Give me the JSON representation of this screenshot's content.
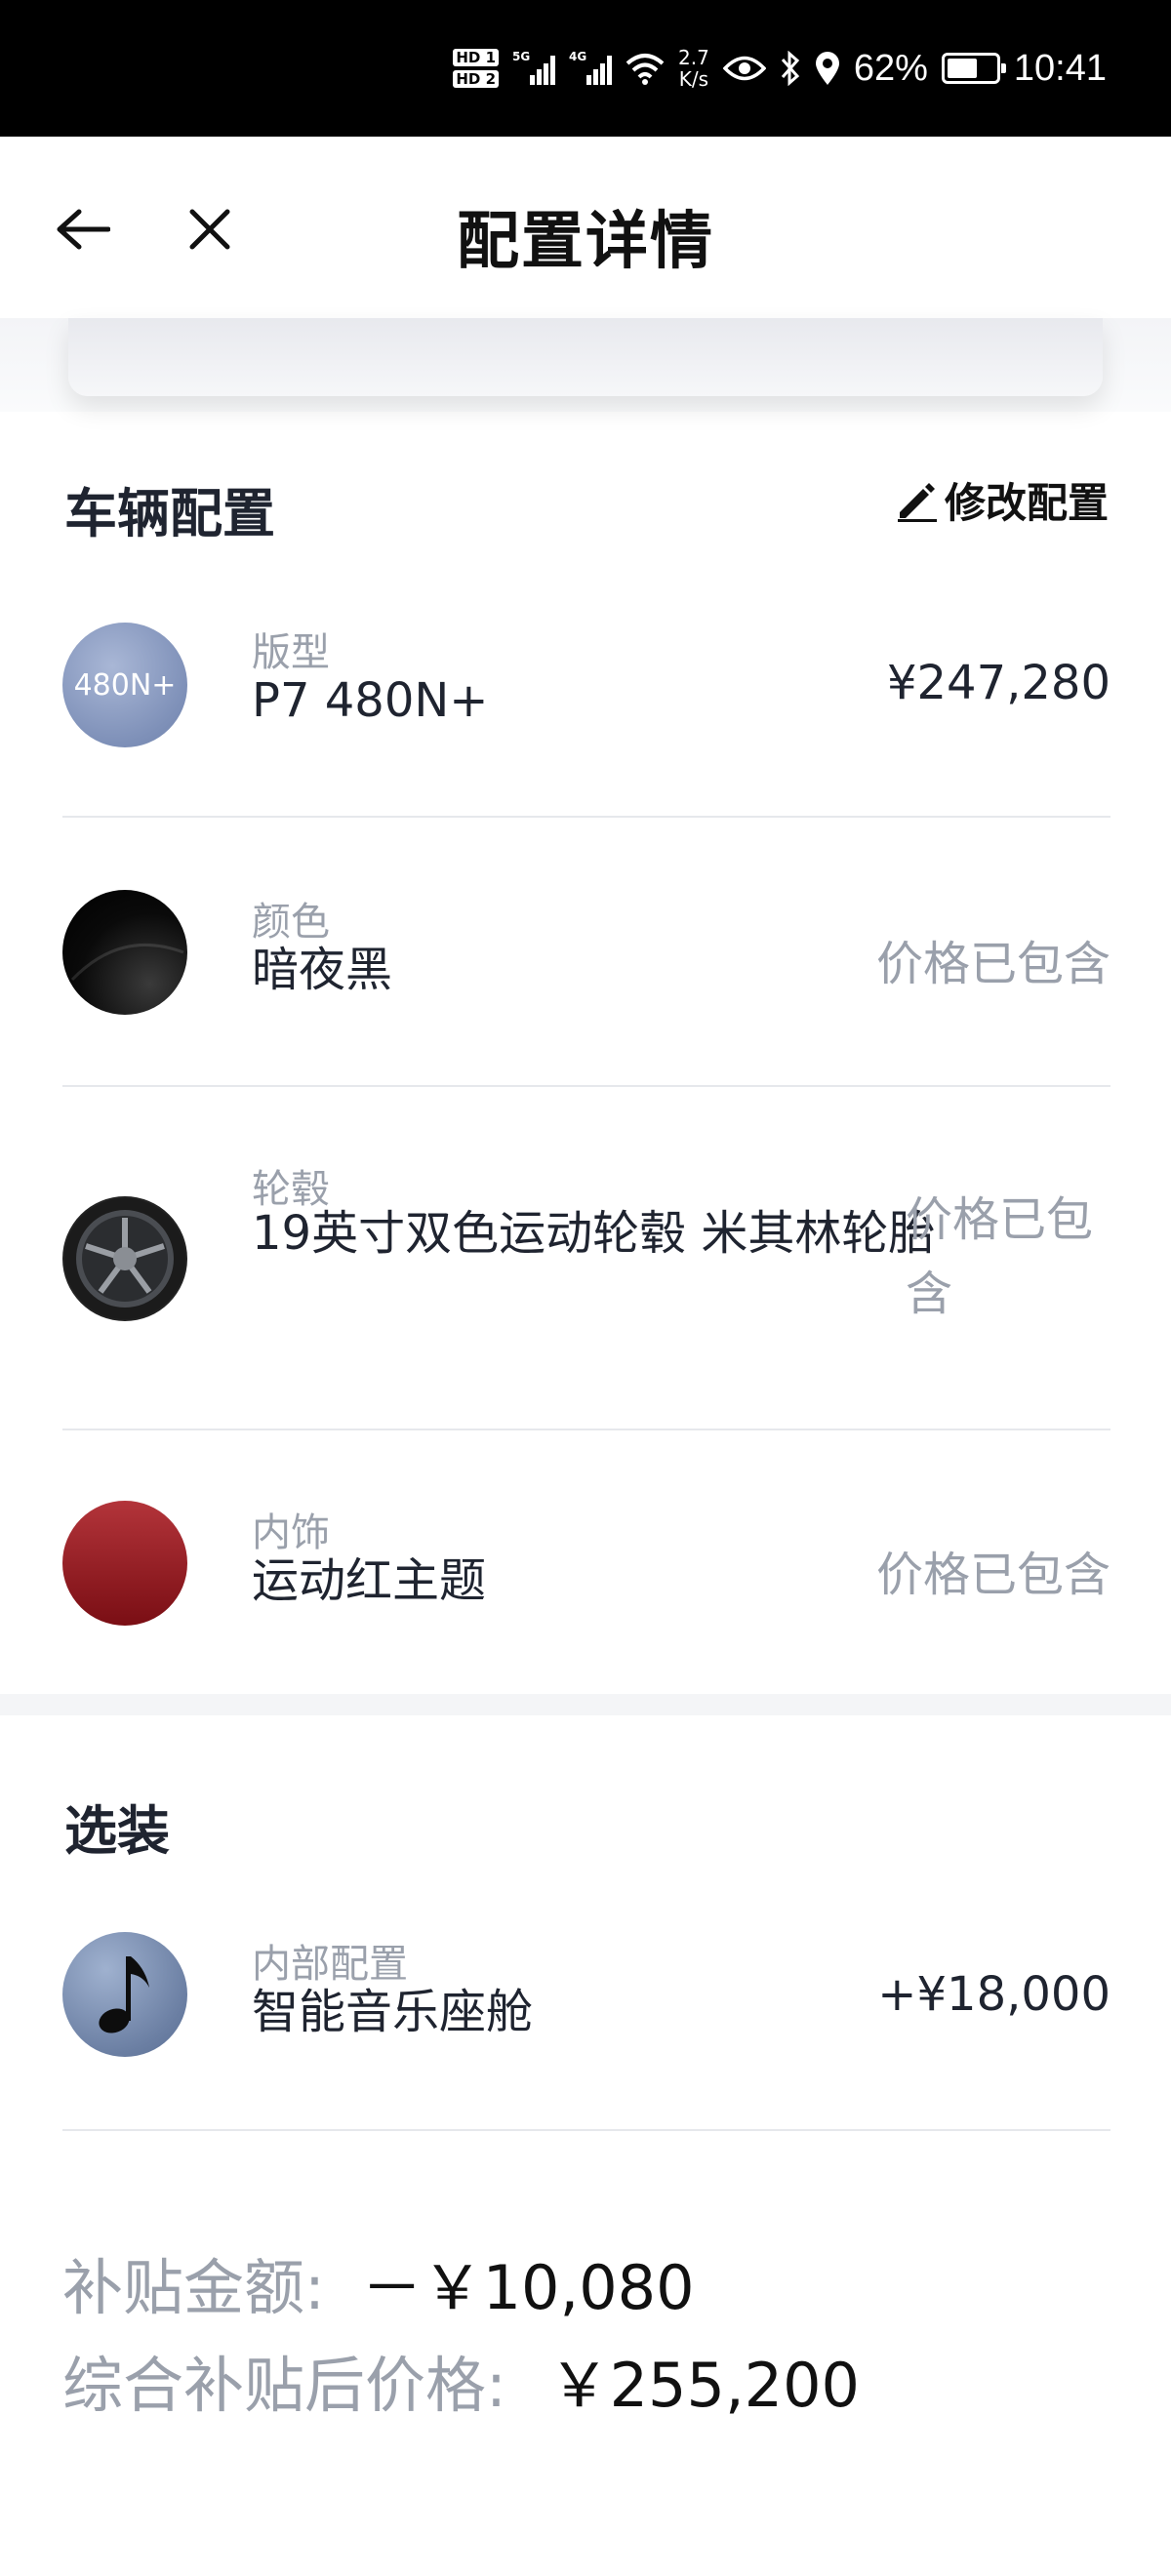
{
  "status_bar": {
    "hd1": "HD 1",
    "hd2": "HD 2",
    "net1": "5G",
    "net2": "4G",
    "speed_value": "2.7",
    "speed_unit": "K/s",
    "battery": "62%",
    "battery_level": 0.62,
    "time": "10:41",
    "icons": [
      "signal-icon",
      "wifi-icon",
      "eye-icon",
      "bluetooth-icon",
      "location-icon",
      "battery-icon"
    ]
  },
  "header": {
    "title": "配置详情",
    "back_icon": "arrow-left-icon",
    "close_icon": "close-icon"
  },
  "vehicle_config": {
    "title": "车辆配置",
    "edit_label": "修改配置",
    "edit_icon": "pencil-icon",
    "items": [
      {
        "category": "版型",
        "name": "P7 480N+",
        "price": "¥247,280",
        "thumb_text": "480N+"
      },
      {
        "category": "颜色",
        "name": "暗夜黑",
        "price": "价格已包含"
      },
      {
        "category": "轮毂",
        "name": "19英寸双色运动轮毂 米其林轮胎",
        "price": "价格已包含"
      },
      {
        "category": "内饰",
        "name": "运动红主题",
        "price": "价格已包含"
      }
    ]
  },
  "options": {
    "title": "选装",
    "items": [
      {
        "category": "内部配置",
        "name": "智能音乐座舱",
        "price": "+¥18,000",
        "thumb_icon": "music-note-icon"
      }
    ]
  },
  "summary": {
    "subsidy_label": "补贴金额:",
    "subsidy_value": "－￥10,080",
    "final_label": "综合补贴后价格:",
    "final_value": "￥255,200"
  },
  "colors": {
    "status_bar_bg": "#000000",
    "text_primary": "#1f2430",
    "text_muted": "#9aa0ab",
    "divider": "#e6e8ec"
  }
}
